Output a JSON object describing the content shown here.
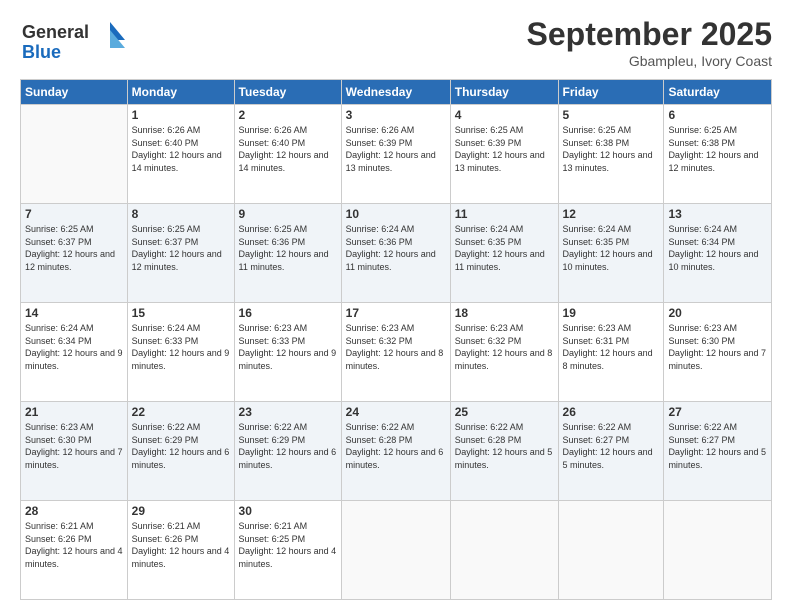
{
  "logo": {
    "line1": "General",
    "line2": "Blue"
  },
  "header": {
    "month": "September 2025",
    "location": "Gbampleu, Ivory Coast"
  },
  "weekdays": [
    "Sunday",
    "Monday",
    "Tuesday",
    "Wednesday",
    "Thursday",
    "Friday",
    "Saturday"
  ],
  "weeks": [
    [
      {
        "day": "",
        "sunrise": "",
        "sunset": "",
        "daylight": ""
      },
      {
        "day": "1",
        "sunrise": "Sunrise: 6:26 AM",
        "sunset": "Sunset: 6:40 PM",
        "daylight": "Daylight: 12 hours and 14 minutes."
      },
      {
        "day": "2",
        "sunrise": "Sunrise: 6:26 AM",
        "sunset": "Sunset: 6:40 PM",
        "daylight": "Daylight: 12 hours and 14 minutes."
      },
      {
        "day": "3",
        "sunrise": "Sunrise: 6:26 AM",
        "sunset": "Sunset: 6:39 PM",
        "daylight": "Daylight: 12 hours and 13 minutes."
      },
      {
        "day": "4",
        "sunrise": "Sunrise: 6:25 AM",
        "sunset": "Sunset: 6:39 PM",
        "daylight": "Daylight: 12 hours and 13 minutes."
      },
      {
        "day": "5",
        "sunrise": "Sunrise: 6:25 AM",
        "sunset": "Sunset: 6:38 PM",
        "daylight": "Daylight: 12 hours and 13 minutes."
      },
      {
        "day": "6",
        "sunrise": "Sunrise: 6:25 AM",
        "sunset": "Sunset: 6:38 PM",
        "daylight": "Daylight: 12 hours and 12 minutes."
      }
    ],
    [
      {
        "day": "7",
        "sunrise": "Sunrise: 6:25 AM",
        "sunset": "Sunset: 6:37 PM",
        "daylight": "Daylight: 12 hours and 12 minutes."
      },
      {
        "day": "8",
        "sunrise": "Sunrise: 6:25 AM",
        "sunset": "Sunset: 6:37 PM",
        "daylight": "Daylight: 12 hours and 12 minutes."
      },
      {
        "day": "9",
        "sunrise": "Sunrise: 6:25 AM",
        "sunset": "Sunset: 6:36 PM",
        "daylight": "Daylight: 12 hours and 11 minutes."
      },
      {
        "day": "10",
        "sunrise": "Sunrise: 6:24 AM",
        "sunset": "Sunset: 6:36 PM",
        "daylight": "Daylight: 12 hours and 11 minutes."
      },
      {
        "day": "11",
        "sunrise": "Sunrise: 6:24 AM",
        "sunset": "Sunset: 6:35 PM",
        "daylight": "Daylight: 12 hours and 11 minutes."
      },
      {
        "day": "12",
        "sunrise": "Sunrise: 6:24 AM",
        "sunset": "Sunset: 6:35 PM",
        "daylight": "Daylight: 12 hours and 10 minutes."
      },
      {
        "day": "13",
        "sunrise": "Sunrise: 6:24 AM",
        "sunset": "Sunset: 6:34 PM",
        "daylight": "Daylight: 12 hours and 10 minutes."
      }
    ],
    [
      {
        "day": "14",
        "sunrise": "Sunrise: 6:24 AM",
        "sunset": "Sunset: 6:34 PM",
        "daylight": "Daylight: 12 hours and 9 minutes."
      },
      {
        "day": "15",
        "sunrise": "Sunrise: 6:24 AM",
        "sunset": "Sunset: 6:33 PM",
        "daylight": "Daylight: 12 hours and 9 minutes."
      },
      {
        "day": "16",
        "sunrise": "Sunrise: 6:23 AM",
        "sunset": "Sunset: 6:33 PM",
        "daylight": "Daylight: 12 hours and 9 minutes."
      },
      {
        "day": "17",
        "sunrise": "Sunrise: 6:23 AM",
        "sunset": "Sunset: 6:32 PM",
        "daylight": "Daylight: 12 hours and 8 minutes."
      },
      {
        "day": "18",
        "sunrise": "Sunrise: 6:23 AM",
        "sunset": "Sunset: 6:32 PM",
        "daylight": "Daylight: 12 hours and 8 minutes."
      },
      {
        "day": "19",
        "sunrise": "Sunrise: 6:23 AM",
        "sunset": "Sunset: 6:31 PM",
        "daylight": "Daylight: 12 hours and 8 minutes."
      },
      {
        "day": "20",
        "sunrise": "Sunrise: 6:23 AM",
        "sunset": "Sunset: 6:30 PM",
        "daylight": "Daylight: 12 hours and 7 minutes."
      }
    ],
    [
      {
        "day": "21",
        "sunrise": "Sunrise: 6:23 AM",
        "sunset": "Sunset: 6:30 PM",
        "daylight": "Daylight: 12 hours and 7 minutes."
      },
      {
        "day": "22",
        "sunrise": "Sunrise: 6:22 AM",
        "sunset": "Sunset: 6:29 PM",
        "daylight": "Daylight: 12 hours and 6 minutes."
      },
      {
        "day": "23",
        "sunrise": "Sunrise: 6:22 AM",
        "sunset": "Sunset: 6:29 PM",
        "daylight": "Daylight: 12 hours and 6 minutes."
      },
      {
        "day": "24",
        "sunrise": "Sunrise: 6:22 AM",
        "sunset": "Sunset: 6:28 PM",
        "daylight": "Daylight: 12 hours and 6 minutes."
      },
      {
        "day": "25",
        "sunrise": "Sunrise: 6:22 AM",
        "sunset": "Sunset: 6:28 PM",
        "daylight": "Daylight: 12 hours and 5 minutes."
      },
      {
        "day": "26",
        "sunrise": "Sunrise: 6:22 AM",
        "sunset": "Sunset: 6:27 PM",
        "daylight": "Daylight: 12 hours and 5 minutes."
      },
      {
        "day": "27",
        "sunrise": "Sunrise: 6:22 AM",
        "sunset": "Sunset: 6:27 PM",
        "daylight": "Daylight: 12 hours and 5 minutes."
      }
    ],
    [
      {
        "day": "28",
        "sunrise": "Sunrise: 6:21 AM",
        "sunset": "Sunset: 6:26 PM",
        "daylight": "Daylight: 12 hours and 4 minutes."
      },
      {
        "day": "29",
        "sunrise": "Sunrise: 6:21 AM",
        "sunset": "Sunset: 6:26 PM",
        "daylight": "Daylight: 12 hours and 4 minutes."
      },
      {
        "day": "30",
        "sunrise": "Sunrise: 6:21 AM",
        "sunset": "Sunset: 6:25 PM",
        "daylight": "Daylight: 12 hours and 4 minutes."
      },
      {
        "day": "",
        "sunrise": "",
        "sunset": "",
        "daylight": ""
      },
      {
        "day": "",
        "sunrise": "",
        "sunset": "",
        "daylight": ""
      },
      {
        "day": "",
        "sunrise": "",
        "sunset": "",
        "daylight": ""
      },
      {
        "day": "",
        "sunrise": "",
        "sunset": "",
        "daylight": ""
      }
    ]
  ]
}
